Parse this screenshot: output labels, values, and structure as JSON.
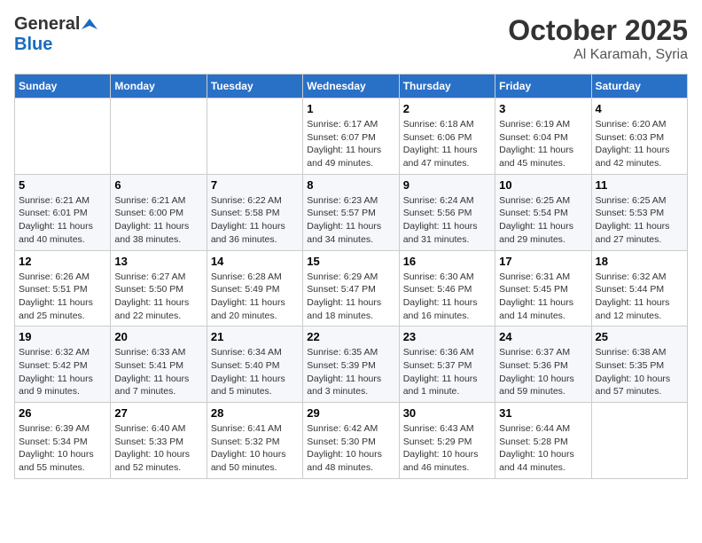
{
  "header": {
    "logo_general": "General",
    "logo_blue": "Blue",
    "title_month": "October 2025",
    "title_location": "Al Karamah, Syria"
  },
  "weekdays": [
    "Sunday",
    "Monday",
    "Tuesday",
    "Wednesday",
    "Thursday",
    "Friday",
    "Saturday"
  ],
  "weeks": [
    [
      {
        "day": "",
        "info": ""
      },
      {
        "day": "",
        "info": ""
      },
      {
        "day": "",
        "info": ""
      },
      {
        "day": "1",
        "info": "Sunrise: 6:17 AM\nSunset: 6:07 PM\nDaylight: 11 hours\nand 49 minutes."
      },
      {
        "day": "2",
        "info": "Sunrise: 6:18 AM\nSunset: 6:06 PM\nDaylight: 11 hours\nand 47 minutes."
      },
      {
        "day": "3",
        "info": "Sunrise: 6:19 AM\nSunset: 6:04 PM\nDaylight: 11 hours\nand 45 minutes."
      },
      {
        "day": "4",
        "info": "Sunrise: 6:20 AM\nSunset: 6:03 PM\nDaylight: 11 hours\nand 42 minutes."
      }
    ],
    [
      {
        "day": "5",
        "info": "Sunrise: 6:21 AM\nSunset: 6:01 PM\nDaylight: 11 hours\nand 40 minutes."
      },
      {
        "day": "6",
        "info": "Sunrise: 6:21 AM\nSunset: 6:00 PM\nDaylight: 11 hours\nand 38 minutes."
      },
      {
        "day": "7",
        "info": "Sunrise: 6:22 AM\nSunset: 5:58 PM\nDaylight: 11 hours\nand 36 minutes."
      },
      {
        "day": "8",
        "info": "Sunrise: 6:23 AM\nSunset: 5:57 PM\nDaylight: 11 hours\nand 34 minutes."
      },
      {
        "day": "9",
        "info": "Sunrise: 6:24 AM\nSunset: 5:56 PM\nDaylight: 11 hours\nand 31 minutes."
      },
      {
        "day": "10",
        "info": "Sunrise: 6:25 AM\nSunset: 5:54 PM\nDaylight: 11 hours\nand 29 minutes."
      },
      {
        "day": "11",
        "info": "Sunrise: 6:25 AM\nSunset: 5:53 PM\nDaylight: 11 hours\nand 27 minutes."
      }
    ],
    [
      {
        "day": "12",
        "info": "Sunrise: 6:26 AM\nSunset: 5:51 PM\nDaylight: 11 hours\nand 25 minutes."
      },
      {
        "day": "13",
        "info": "Sunrise: 6:27 AM\nSunset: 5:50 PM\nDaylight: 11 hours\nand 22 minutes."
      },
      {
        "day": "14",
        "info": "Sunrise: 6:28 AM\nSunset: 5:49 PM\nDaylight: 11 hours\nand 20 minutes."
      },
      {
        "day": "15",
        "info": "Sunrise: 6:29 AM\nSunset: 5:47 PM\nDaylight: 11 hours\nand 18 minutes."
      },
      {
        "day": "16",
        "info": "Sunrise: 6:30 AM\nSunset: 5:46 PM\nDaylight: 11 hours\nand 16 minutes."
      },
      {
        "day": "17",
        "info": "Sunrise: 6:31 AM\nSunset: 5:45 PM\nDaylight: 11 hours\nand 14 minutes."
      },
      {
        "day": "18",
        "info": "Sunrise: 6:32 AM\nSunset: 5:44 PM\nDaylight: 11 hours\nand 12 minutes."
      }
    ],
    [
      {
        "day": "19",
        "info": "Sunrise: 6:32 AM\nSunset: 5:42 PM\nDaylight: 11 hours\nand 9 minutes."
      },
      {
        "day": "20",
        "info": "Sunrise: 6:33 AM\nSunset: 5:41 PM\nDaylight: 11 hours\nand 7 minutes."
      },
      {
        "day": "21",
        "info": "Sunrise: 6:34 AM\nSunset: 5:40 PM\nDaylight: 11 hours\nand 5 minutes."
      },
      {
        "day": "22",
        "info": "Sunrise: 6:35 AM\nSunset: 5:39 PM\nDaylight: 11 hours\nand 3 minutes."
      },
      {
        "day": "23",
        "info": "Sunrise: 6:36 AM\nSunset: 5:37 PM\nDaylight: 11 hours\nand 1 minute."
      },
      {
        "day": "24",
        "info": "Sunrise: 6:37 AM\nSunset: 5:36 PM\nDaylight: 10 hours\nand 59 minutes."
      },
      {
        "day": "25",
        "info": "Sunrise: 6:38 AM\nSunset: 5:35 PM\nDaylight: 10 hours\nand 57 minutes."
      }
    ],
    [
      {
        "day": "26",
        "info": "Sunrise: 6:39 AM\nSunset: 5:34 PM\nDaylight: 10 hours\nand 55 minutes."
      },
      {
        "day": "27",
        "info": "Sunrise: 6:40 AM\nSunset: 5:33 PM\nDaylight: 10 hours\nand 52 minutes."
      },
      {
        "day": "28",
        "info": "Sunrise: 6:41 AM\nSunset: 5:32 PM\nDaylight: 10 hours\nand 50 minutes."
      },
      {
        "day": "29",
        "info": "Sunrise: 6:42 AM\nSunset: 5:30 PM\nDaylight: 10 hours\nand 48 minutes."
      },
      {
        "day": "30",
        "info": "Sunrise: 6:43 AM\nSunset: 5:29 PM\nDaylight: 10 hours\nand 46 minutes."
      },
      {
        "day": "31",
        "info": "Sunrise: 6:44 AM\nSunset: 5:28 PM\nDaylight: 10 hours\nand 44 minutes."
      },
      {
        "day": "",
        "info": ""
      }
    ]
  ]
}
